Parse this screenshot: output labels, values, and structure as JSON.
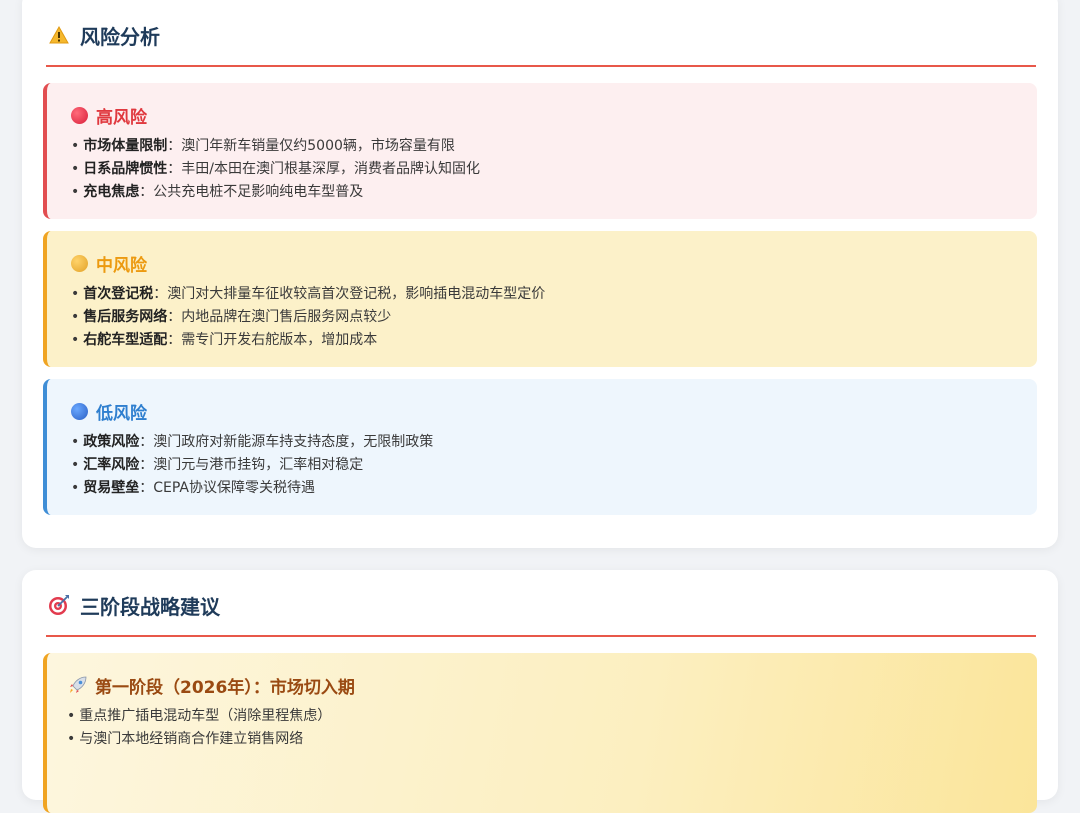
{
  "risk_section": {
    "icon": "warning-icon",
    "title": "风险分析",
    "high": {
      "icon": "red-circle-icon",
      "title": "高风险",
      "color": "#e0393f",
      "items": [
        {
          "label": "市场体量限制",
          "sep": "：",
          "text": "澳门年新车销量仅约5000辆，市场容量有限"
        },
        {
          "label": "日系品牌惯性",
          "sep": "：",
          "text": "丰田/本田在澳门根基深厚，消费者品牌认知固化"
        },
        {
          "label": "充电焦虑",
          "sep": "：",
          "text": "公共充电桩不足影响纯电车型普及"
        }
      ]
    },
    "mid": {
      "icon": "yellow-circle-icon",
      "title": "中风险",
      "color": "#ec9a10",
      "items": [
        {
          "label": "首次登记税",
          "sep": "：",
          "text": "澳门对大排量车征收较高首次登记税，影响插电混动车型定价"
        },
        {
          "label": "售后服务网络",
          "sep": "：",
          "text": "内地品牌在澳门售后服务网点较少"
        },
        {
          "label": "右舵车型适配",
          "sep": "：",
          "text": "需专门开发右舵版本，增加成本"
        }
      ]
    },
    "low": {
      "icon": "blue-circle-icon",
      "title": "低风险",
      "color": "#2f7fcf",
      "items": [
        {
          "label": "政策风险",
          "sep": "：",
          "text": "澳门政府对新能源车持支持态度，无限制政策"
        },
        {
          "label": "汇率风险",
          "sep": "：",
          "text": "澳门元与港币挂钩，汇率相对稳定"
        },
        {
          "label": "贸易壁垒",
          "sep": "：",
          "text": "CEPA协议保障零关税待遇"
        }
      ]
    }
  },
  "strategy_section": {
    "icon": "target-icon",
    "title": "三阶段战略建议",
    "stage1": {
      "icon": "rocket-icon",
      "title": "第一阶段（2026年）：市场切入期",
      "items": [
        "重点推广插电混动车型（消除里程焦虑）",
        "与澳门本地经销商合作建立销售网络"
      ]
    }
  },
  "bullet": "•"
}
